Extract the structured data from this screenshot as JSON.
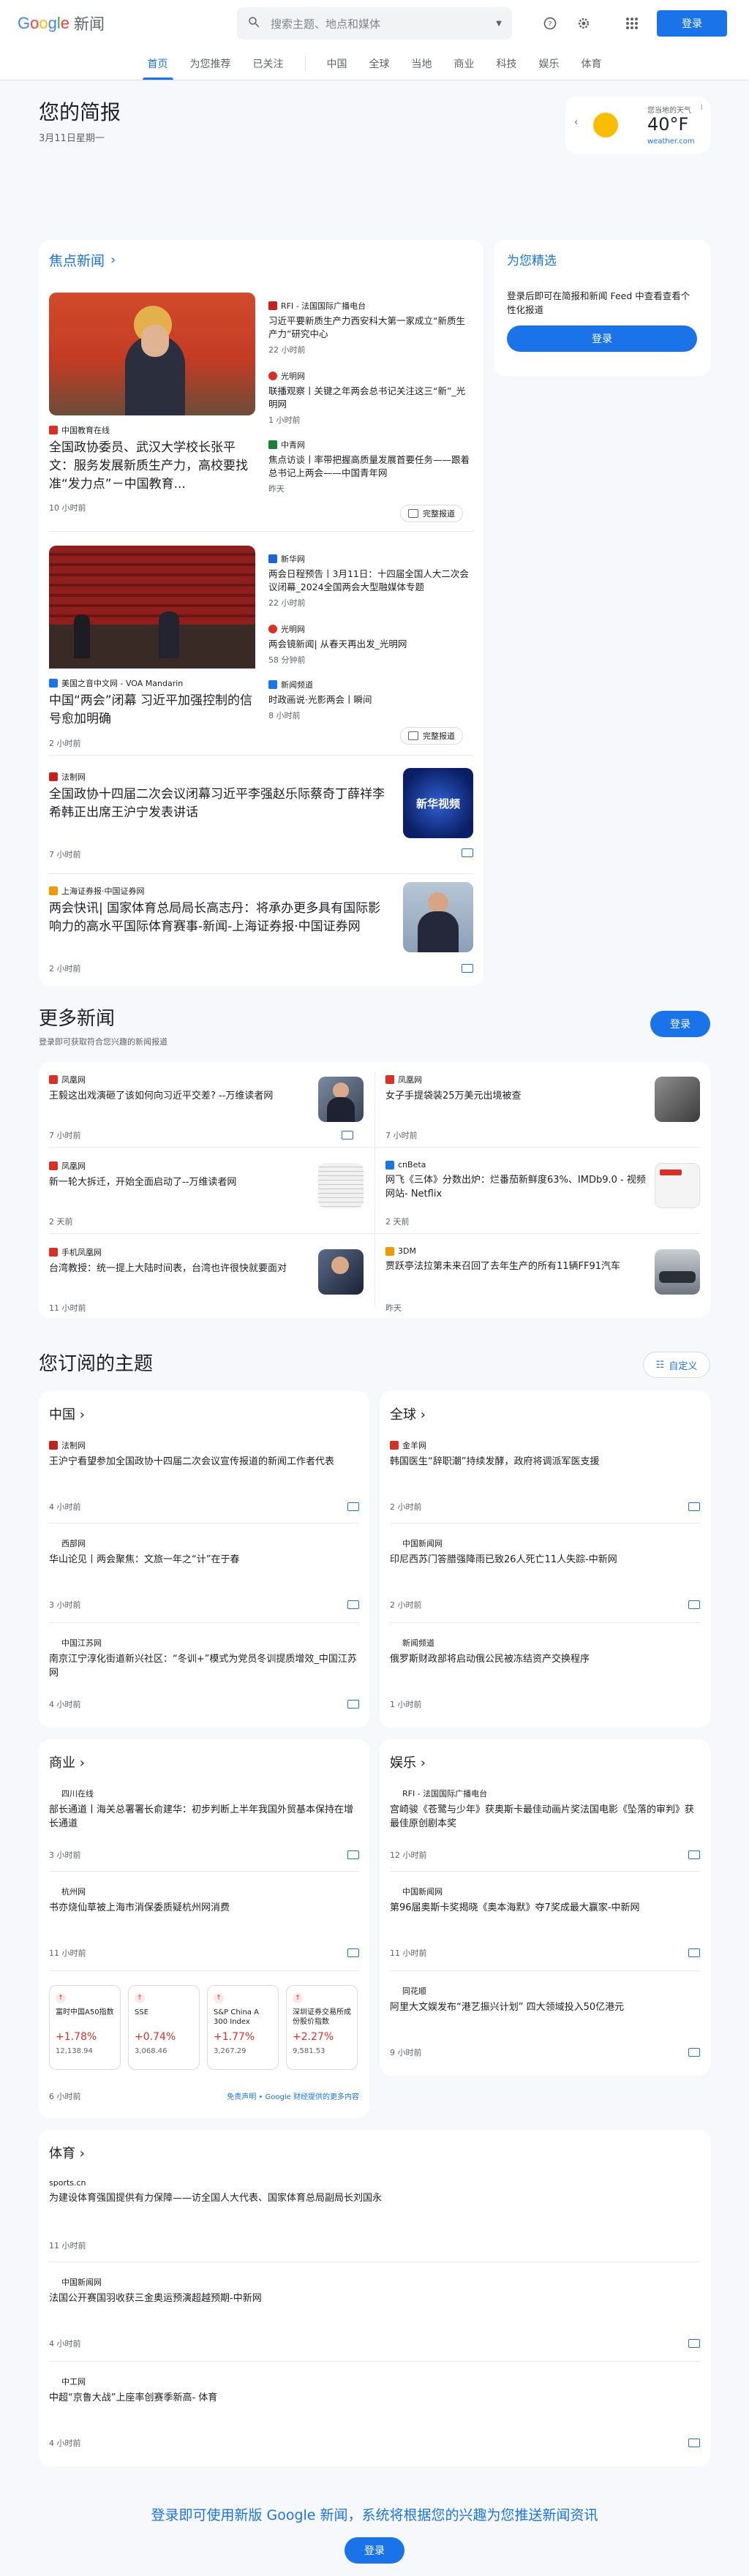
{
  "header": {
    "logo_news": "新闻",
    "search_placeholder": "搜索主题、地点和媒体",
    "signin": "登录"
  },
  "nav": {
    "tabs": [
      "首页",
      "为您推荐",
      "已关注"
    ],
    "tabs2": [
      "中国",
      "全球",
      "当地",
      "商业",
      "科技",
      "娱乐",
      "体育"
    ]
  },
  "brief": {
    "title": "您的简报",
    "date": "3月11日星期一"
  },
  "weather": {
    "label": "您当地的天气",
    "temp": "40°F",
    "source": "weather.com"
  },
  "top": {
    "title": "焦点新闻",
    "full_coverage": "完整报道",
    "s1": {
      "main_src": "中国教育在线",
      "main_hl": "全国政协委员、武汉大学校长张平文：服务发展新质生产力，高校要找准“发力点”－中国教育...",
      "main_ts": "10 小时前",
      "side": [
        {
          "src": "RFI - 法国国际广播电台",
          "hl": "习近平要新质生产力西安科大第一家成立“新质生产力”研究中心",
          "ts": "22 小时前"
        },
        {
          "src": "光明网",
          "hl": "联播观察丨关键之年两会总书记关注这三“新”_光明网",
          "ts": "1 小时前"
        },
        {
          "src": "中青网",
          "hl": "焦点访谈丨率带把握高质量发展首要任务——跟着总书记上两会——中国青年网",
          "ts": "昨天"
        }
      ]
    },
    "s2": {
      "main_src": "美国之音中文网 - VOA Mandarin",
      "main_hl": "中国“两会”闭幕 习近平加强控制的信号愈加明确",
      "main_ts": "2 小时前",
      "side": [
        {
          "src": "新华网",
          "hl": "两会日程预告丨3月11日：十四届全国人大二次会议闭幕_2024全国两会大型融媒体专题",
          "ts": "22 小时前"
        },
        {
          "src": "光明网",
          "hl": "两会镜新闻| 从春天再出发_光明网",
          "ts": "58 分钟前"
        },
        {
          "src": "新闻频道",
          "hl": "时政画说·光影两会丨瞬间",
          "ts": "8 小时前"
        }
      ]
    },
    "s3": {
      "src": "法制网",
      "hl": "全国政协十四届二次会议闭幕习近平李强赵乐际蔡奇丁薛祥李希韩正出席王沪宁发表讲话",
      "ts": "7 小时前",
      "img_text": "新华视频"
    },
    "s4": {
      "src": "上海证券报·中国证券网",
      "hl": "两会快讯| 国家体育总局局长高志丹：将承办更多具有国际影响力的高水平国际体育赛事-新闻-上海证券报·中国证券网",
      "ts": "2 小时前"
    }
  },
  "picks": {
    "title": "为您精选",
    "text": "登录后即可在简报和新闻 Feed 中查看查看个性化报道",
    "btn": "登录"
  },
  "more": {
    "title": "更多新闻",
    "sub": "登录即可获取符合您兴趣的新闻报道",
    "btn": "登录",
    "items": [
      {
        "src": "凤凰网",
        "hl": "王毅这出戏演砸了该如何向习近平交差? --万维读者网",
        "ts": "7 小时前"
      },
      {
        "src": "凤凰网",
        "hl": "女子手提袋装25万美元出境被查",
        "ts": "7 小时前"
      },
      {
        "src": "凤凰网",
        "hl": "新一轮大拆迁，开始全面启动了--万维读者网",
        "ts": "2 天前"
      },
      {
        "src": "cnBeta",
        "hl": "网飞《三体》分数出炉：烂番茄新鲜度63%、IMDb9.0 - 视频网站- Netflix",
        "ts": "2 天前"
      },
      {
        "src": "手机凤凰网",
        "hl": "台湾教授：统一提上大陆时间表，台湾也许很快就要面对",
        "ts": "11 小时前"
      },
      {
        "src": "3DM",
        "hl": "贾跃亭法拉第未来召回了去年生产的所有11辆FF91汽车",
        "ts": "昨天"
      }
    ]
  },
  "topics": {
    "title": "您订阅的主题",
    "customize": "自定义",
    "china": {
      "name": "中国",
      "items": [
        {
          "src": "法制网",
          "hl": "王沪宁看望参加全国政协十四届二次会议宣传报道的新闻工作者代表",
          "ts": "4 小时前"
        },
        {
          "src": "西部网",
          "hl": "华山论见丨两会聚焦：文旅一年之“计”在于春",
          "ts": "3 小时前"
        },
        {
          "src": "中国江苏网",
          "hl": "南京江宁淳化街道新兴社区：“冬训+”模式为党员冬训提质增效_中国江苏网",
          "ts": "4 小时前"
        }
      ]
    },
    "world": {
      "name": "全球",
      "items": [
        {
          "src": "金羊网",
          "hl": "韩国医生“辞职潮”持续发酵，政府将调派军医支援",
          "ts": "2 小时前"
        },
        {
          "src": "中国新闻网",
          "hl": "印尼西苏门答腊强降雨已致26人死亡11人失踪-中新网",
          "ts": "2 小时前"
        },
        {
          "src": "新闻频道",
          "hl": "俄罗斯财政部将启动俄公民被冻结资产交换程序",
          "ts": "1 小时前"
        }
      ]
    },
    "business": {
      "name": "商业",
      "items": [
        {
          "src": "四川在线",
          "hl": "部长通道丨海关总署署长俞建华：初步判断上半年我国外贸基本保持在增长通道",
          "ts": "3 小时前"
        },
        {
          "src": "杭州网",
          "hl": "书亦烧仙草被上海市消保委质疑杭州网消费",
          "ts": "11 小时前"
        }
      ],
      "stocks": [
        {
          "name": "富时中国A50指数",
          "pct": "+1.78%",
          "val": "12,138.94"
        },
        {
          "name": "SSE",
          "pct": "+0.74%",
          "val": "3,068.46"
        },
        {
          "name": "S&P China A 300 Index (CNY)",
          "pct": "+1.77%",
          "val": "3,267.29"
        },
        {
          "name": "深圳证券交易所成份股价指数",
          "pct": "+2.27%",
          "val": "9,581.53"
        }
      ],
      "stock_ts": "6 小时前",
      "disclaimer": "免责声明 • Google 财经提供的更多内容"
    },
    "ent": {
      "name": "娱乐",
      "items": [
        {
          "src": "RFI - 法国国际广播电台",
          "hl": "宫崎骏《苍鹭与少年》获奥斯卡最佳动画片奖法国电影《坠落的审判》获最佳原创剧本奖",
          "ts": "12 小时前"
        },
        {
          "src": "中国新闻网",
          "hl": "第96届奥斯卡奖揭晓《奥本海默》夺7奖成最大赢家-中新网",
          "ts": "11 小时前"
        },
        {
          "src": "同花顺",
          "hl": "阿里大文娱发布“港艺振兴计划” 四大领域投入50亿港元",
          "ts": "9 小时前"
        }
      ]
    },
    "sports": {
      "name": "体育",
      "items": [
        {
          "src": "sports.cn",
          "hl": "为建设体育强国提供有力保障——访全国人大代表、国家体育总局副局长刘国永",
          "ts": "11 小时前"
        },
        {
          "src": "中国新闻网",
          "hl": "法国公开赛国羽收获三金奥运预演超越预期-中新网",
          "ts": "4 小时前"
        },
        {
          "src": "中工网",
          "hl": "中超“京鲁大战”上座率创赛季新高- 体育",
          "ts": "4 小时前"
        }
      ]
    }
  },
  "footer": {
    "text": "登录即可使用新版 Google 新闻，系统将根据您的兴趣为您推送新闻资讯",
    "btn": "登录"
  }
}
